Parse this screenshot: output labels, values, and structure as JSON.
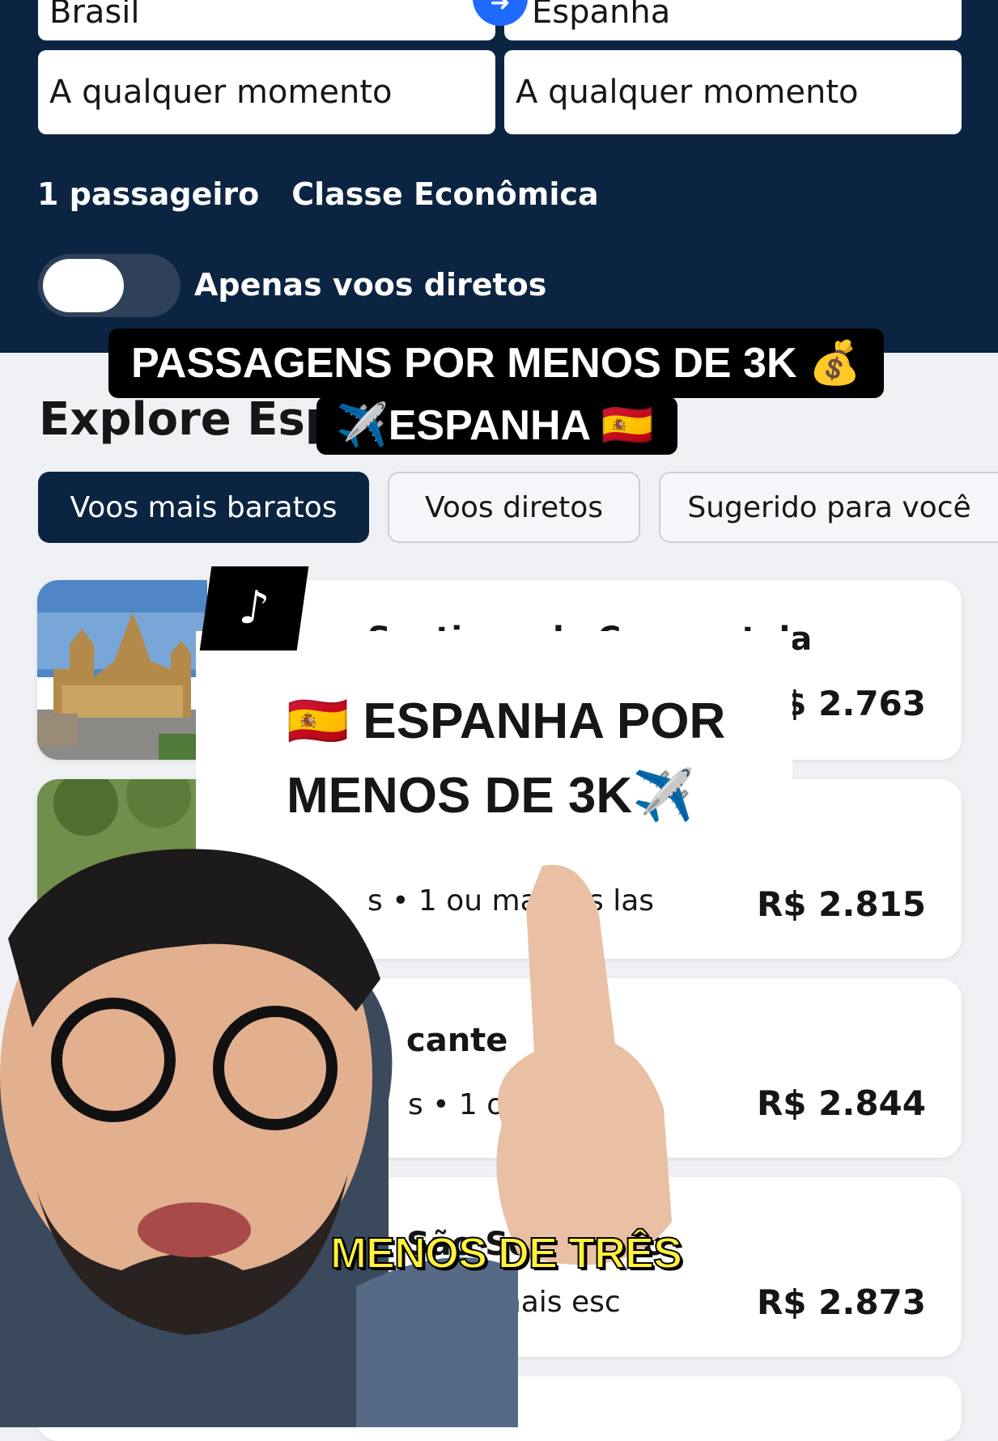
{
  "search": {
    "origin": "Brasil",
    "destination": "Espanha",
    "depart": "A qualquer momento",
    "return": "A qualquer momento",
    "passengers": "1 passageiro",
    "cabin": "Classe Econômica",
    "direct_only_label": "Apenas voos diretos",
    "direct_only": false
  },
  "explore": {
    "title": "Explore Esp",
    "tabs": [
      {
        "label": "Voos mais baratos",
        "active": true
      },
      {
        "label": "Voos diretos",
        "active": false
      },
      {
        "label": "Sugerido para você",
        "active": false
      }
    ]
  },
  "results": [
    {
      "name": "Santiago de Compostela",
      "meta": "",
      "price": "R$ 2.763"
    },
    {
      "name": "",
      "meta": "s • 1 ou mais es    las",
      "price": "R$ 2.815"
    },
    {
      "name": "cante",
      "meta": "s • 1 ou mais",
      "price": "R$ 2.844"
    },
    {
      "name": "São Sebastião",
      "meta": "1 ou mais esc",
      "price": "R$ 2.873"
    }
  ],
  "overlay": {
    "caption1": "PASSAGENS POR MENOS DE 3K 💰",
    "caption2": "✈️ESPANHA 🇪🇸",
    "headline": "🇪🇸 ESPANHA POR MENOS DE 3K✈️",
    "subtitle": "MENOS DE TRÊS",
    "tiktok_glyph": "♪"
  },
  "colors": {
    "navy": "#0b2441",
    "accent": "#1f6bff",
    "subtitle": "#fff23a"
  }
}
